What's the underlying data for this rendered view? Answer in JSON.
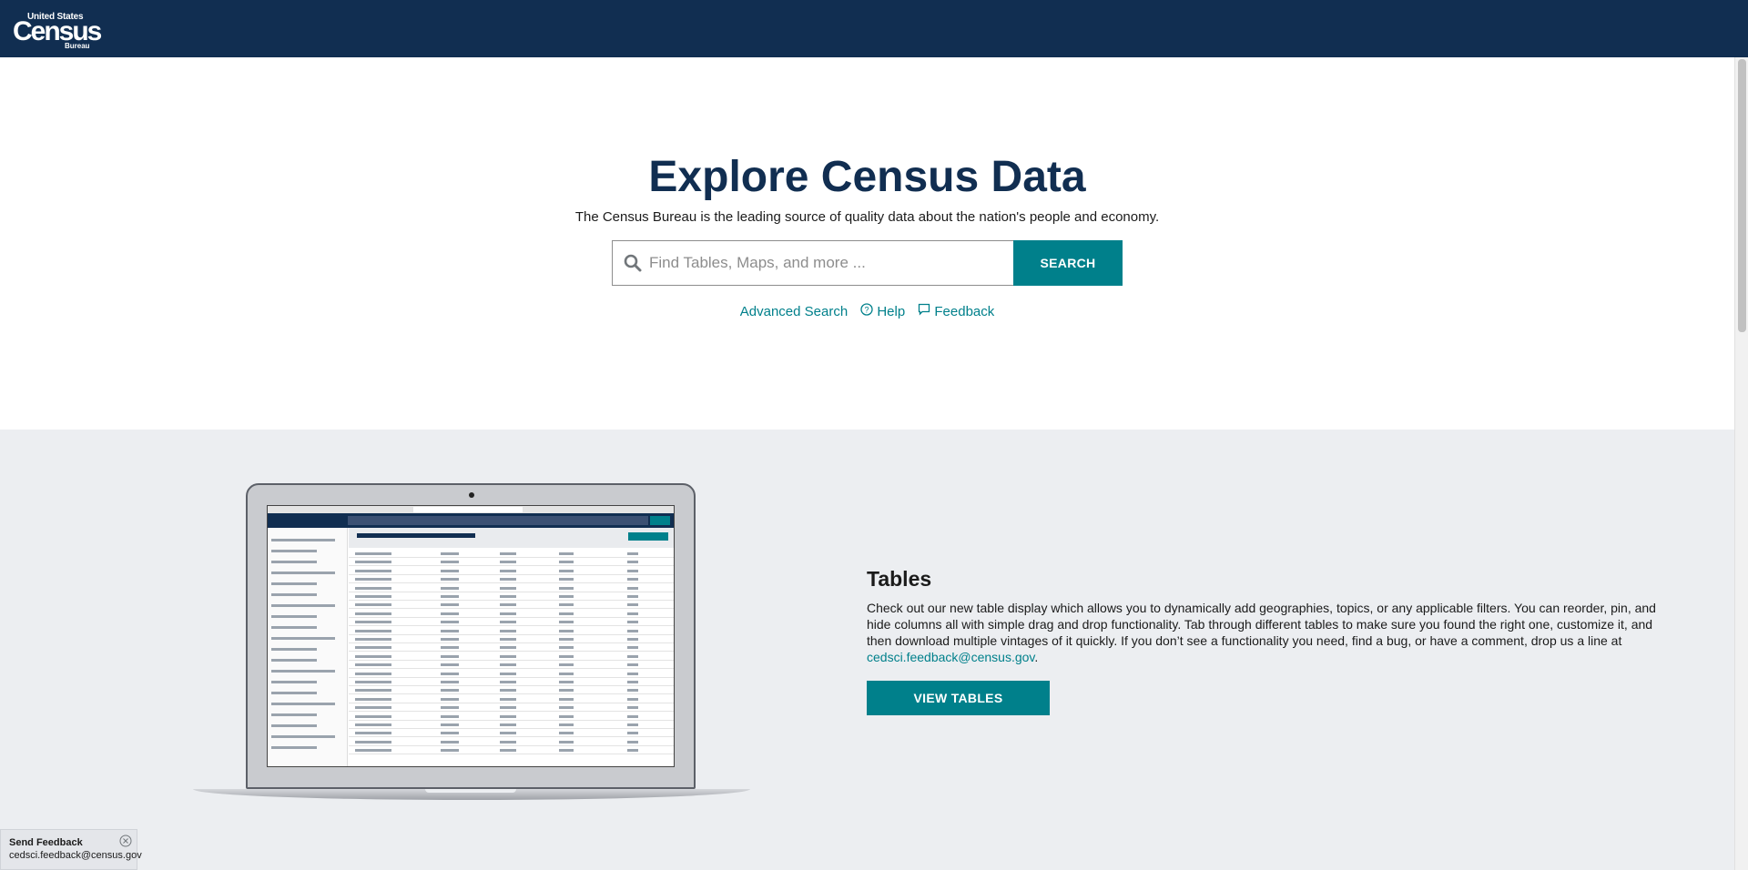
{
  "header": {
    "logo_top": "United States",
    "logo_main": "Census",
    "logo_bottom": "Bureau"
  },
  "hero": {
    "title": "Explore Census Data",
    "subtitle": "The Census Bureau is the leading source of quality data about the nation's people and economy.",
    "search_placeholder": "Find Tables, Maps, and more ...",
    "search_button": "SEARCH",
    "links": {
      "advanced": "Advanced Search",
      "help": "Help",
      "feedback": "Feedback"
    }
  },
  "tables_section": {
    "title": "Tables",
    "description": "Check out our new table display which allows you to dynamically add geographies, topics, or any applicable filters. You can reorder, pin, and hide columns all with simple drag and drop functionality. Tab through different tables to make sure you found the right one, customize it, and then download multiple vintages of it quickly. If you don’t see a functionality you need, find a bug, or have a comment, drop us a line at",
    "email": "cedsci.feedback@census.gov",
    "email_suffix": ".",
    "button": "VIEW TABLES"
  },
  "feedback_widget": {
    "title": "Send Feedback",
    "email": "cedsci.feedback@census.gov"
  },
  "icons": {
    "search": "search-icon",
    "help": "question-circle-icon",
    "feedback": "comment-icon",
    "close": "close-circle-icon"
  },
  "colors": {
    "navy": "#112e51",
    "teal": "#00808b",
    "section_bg": "#eceef1"
  }
}
